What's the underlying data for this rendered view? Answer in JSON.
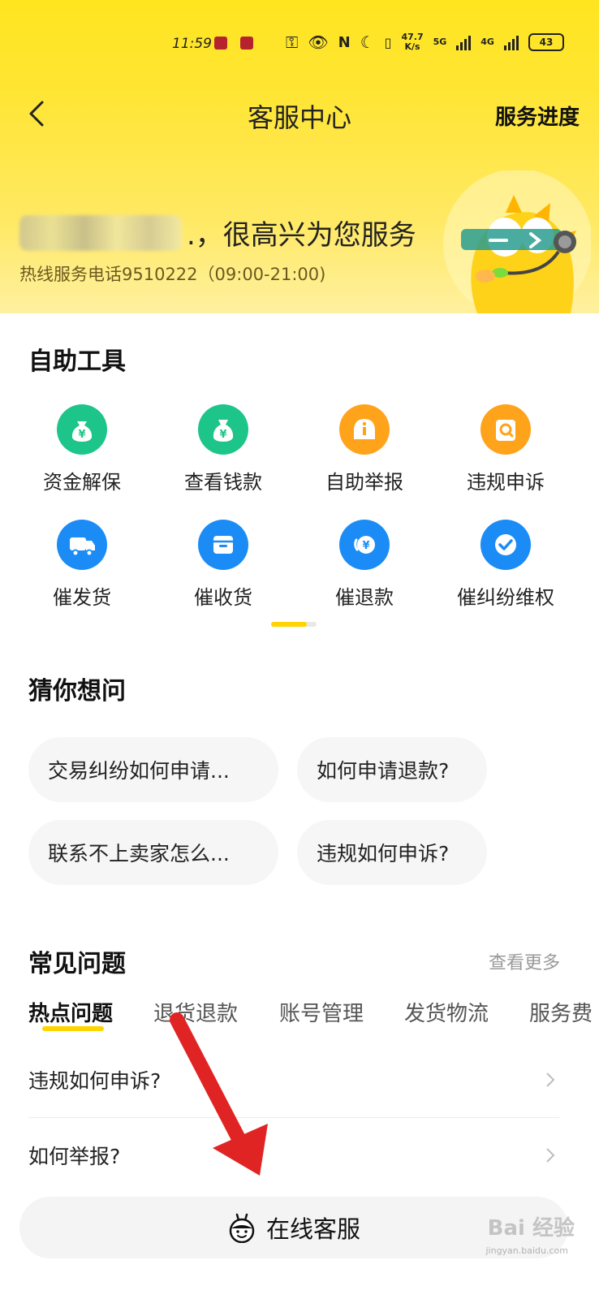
{
  "status_bar": {
    "time": "11:59",
    "net_speed_value": "47.7",
    "net_speed_unit": "K/s",
    "signal_5g": "5G",
    "signal_4g": "4G",
    "battery": "43"
  },
  "nav": {
    "title": "客服中心",
    "progress_label": "服务进度"
  },
  "hero": {
    "greeting_suffix": ".，很高兴为您服务",
    "hotline": "热线服务电话9510222（09:00-21:00)"
  },
  "self_service": {
    "title": "自助工具",
    "tools": [
      {
        "label": "资金解保",
        "icon": "money-bag-yen-icon",
        "color": "#1ec58a"
      },
      {
        "label": "查看钱款",
        "icon": "money-bag-yen-icon",
        "color": "#1ec58a"
      },
      {
        "label": "自助举报",
        "icon": "info-icon",
        "color": "#ffa31a"
      },
      {
        "label": "违规申诉",
        "icon": "appeal-search-icon",
        "color": "#ffa31a"
      },
      {
        "label": "催发货",
        "icon": "truck-icon",
        "color": "#1b8cf5"
      },
      {
        "label": "催收货",
        "icon": "package-icon",
        "color": "#1b8cf5"
      },
      {
        "label": "催退款",
        "icon": "refund-yen-icon",
        "color": "#1b8cf5"
      },
      {
        "label": "催纠纷维权",
        "icon": "check-shield-icon",
        "color": "#1b8cf5"
      }
    ]
  },
  "guess": {
    "title": "猜你想问",
    "questions": [
      "交易纠纷如何申请...",
      "如何申请退款?",
      "联系不上卖家怎么...",
      "违规如何申诉?"
    ]
  },
  "faq": {
    "title": "常见问题",
    "more_label": "查看更多",
    "tabs": [
      "热点问题",
      "退货退款",
      "账号管理",
      "发货物流",
      "服务费"
    ],
    "active_tab": "热点问题",
    "items": [
      "违规如何申诉?",
      "如何举报?"
    ]
  },
  "online_service": {
    "label": "在线客服"
  },
  "watermark": {
    "text": "Bai 经验",
    "sub": "jingyan.baidu.com"
  },
  "colors": {
    "brand_yellow": "#ffe51f",
    "accent_yellow": "#ffd400",
    "arrow_red": "#e02424"
  }
}
